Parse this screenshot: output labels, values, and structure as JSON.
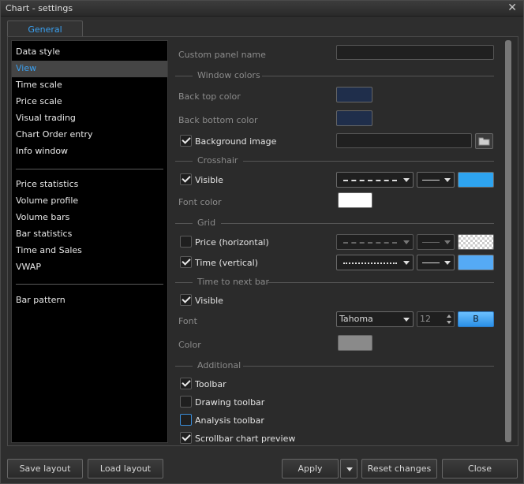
{
  "window": {
    "title": "Chart - settings",
    "close_glyph": "✕"
  },
  "tabs": [
    {
      "label": "General"
    }
  ],
  "sidebar": {
    "items": [
      {
        "label": "Data style"
      },
      {
        "label": "View",
        "selected": true
      },
      {
        "label": "Time scale"
      },
      {
        "label": "Price scale"
      },
      {
        "label": "Visual trading"
      },
      {
        "label": "Chart Order entry"
      },
      {
        "label": "Info window"
      },
      {
        "label": "Price  statistics"
      },
      {
        "label": "Volume profile"
      },
      {
        "label": "Volume bars"
      },
      {
        "label": "Bar statistics"
      },
      {
        "label": "Time and Sales"
      },
      {
        "label": "VWAP"
      },
      {
        "label": "Bar pattern"
      }
    ]
  },
  "view": {
    "custom_panel_name": {
      "label": "Custom panel name",
      "value": ""
    },
    "window_colors": {
      "header": "Window colors",
      "back_top_color": {
        "label": "Back top color",
        "color": "#1f2e4b"
      },
      "back_bottom_color": {
        "label": "Back bottom color",
        "color": "#1f2e4b"
      },
      "background_image": {
        "label": "Background image",
        "checked": true,
        "value": ""
      }
    },
    "crosshair": {
      "header": "Crosshair",
      "visible": {
        "label": "Visible",
        "checked": true,
        "line_style": "dashed",
        "line_width": "thin",
        "color": "#2ea4f0"
      },
      "font_color": {
        "label": "Font color",
        "color": "#ffffff"
      }
    },
    "grid": {
      "header": "Grid",
      "price_horizontal": {
        "label": "Price (horizontal)",
        "checked": false,
        "enabled": false,
        "line_style": "dashed",
        "line_width": "thin",
        "color": "transparent"
      },
      "time_vertical": {
        "label": "Time (vertical)",
        "checked": true,
        "line_style": "dotted",
        "line_width": "thin",
        "color": "#55aaf5"
      }
    },
    "time_to_next_bar": {
      "header": "Time to next bar",
      "visible": {
        "label": "Visible",
        "checked": true
      },
      "font": {
        "label": "Font",
        "family": "Tahoma",
        "size": "12",
        "bold_label": "B",
        "bold_active": true
      },
      "color": {
        "label": "Color",
        "color": "#8a8a8a"
      }
    },
    "additional": {
      "header": "Additional",
      "toolbar": {
        "label": "Toolbar",
        "checked": true
      },
      "drawing_toolbar": {
        "label": "Drawing toolbar",
        "checked": false
      },
      "analysis_toolbar": {
        "label": "Analysis  toolbar",
        "checked": false
      },
      "scrollbar_chart_preview": {
        "label": "Scrollbar chart preview",
        "checked": true
      }
    }
  },
  "footer": {
    "save_layout": "Save layout",
    "load_layout": "Load layout",
    "apply": "Apply",
    "reset_changes": "Reset changes",
    "close": "Close"
  }
}
